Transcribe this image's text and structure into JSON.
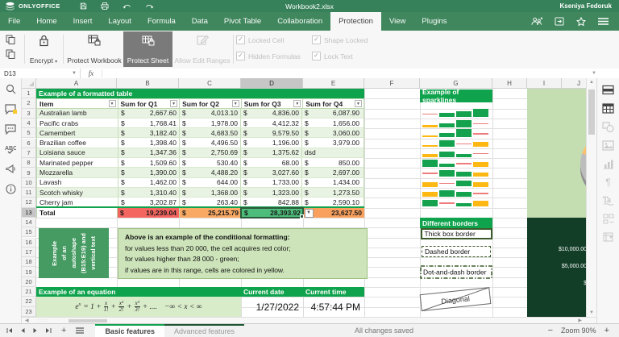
{
  "titlebar": {
    "logo_text": "ONLYOFFICE",
    "doc_title": "Workbook2.xlsx",
    "user_name": "Kseniya Fedoruk"
  },
  "menubar": {
    "tabs": [
      "File",
      "Home",
      "Insert",
      "Layout",
      "Formula",
      "Data",
      "Pivot Table",
      "Collaboration",
      "Protection",
      "View",
      "Plugins"
    ],
    "active_tab": "Protection"
  },
  "ribbon": {
    "encrypt_label": "Encrypt",
    "protect_workbook_label": "Protect Workbook",
    "protect_sheet_label": "Protect Sheet",
    "allow_edit_ranges_label": "Allow Edit Ranges",
    "checkboxes": [
      {
        "label": "Locked Cell",
        "checked": true
      },
      {
        "label": "Shape Locked",
        "checked": true
      },
      {
        "label": "Hidden Formulas",
        "checked": true
      },
      {
        "label": "Lock Text",
        "checked": true
      }
    ]
  },
  "formula_bar": {
    "name_box": "D13",
    "fx_label": "fx",
    "value": ""
  },
  "grid": {
    "column_letters": [
      "A",
      "B",
      "C",
      "D",
      "E",
      "F",
      "G",
      "H",
      "I",
      "J"
    ],
    "active_column": "D",
    "row_count": 23,
    "active_row": 13
  },
  "table": {
    "title": "Example of a formatted table",
    "currency": "$",
    "headers": [
      "Item",
      "Sum for Q1",
      "Sum for Q2",
      "Sum for Q3",
      "Sum for Q4"
    ],
    "rows": [
      {
        "item": "Australian lamb",
        "q1": "2,667.60",
        "q2": "4,013.10",
        "q3": "4,836.00",
        "q4": "6,087.90"
      },
      {
        "item": "Pacific crabs",
        "q1": "1,768.41",
        "q2": "1,978.00",
        "q3": "4,412.32",
        "q4": "1,656.00"
      },
      {
        "item": "Camembert",
        "q1": "3,182.40",
        "q2": "4,683.50",
        "q3": "9,579.50",
        "q4": "3,060.00"
      },
      {
        "item": "Brazilian coffee",
        "q1": "1,398.40",
        "q2": "4,496.50",
        "q3": "1,196.00",
        "q4": "3,979.00"
      },
      {
        "item": "Loisiana sauce",
        "q1": "1,347.36",
        "q2": "2,750.69",
        "q3": "1,375.62",
        "q4": "dsd",
        "q4_is_text": true
      },
      {
        "item": "Marinated pepper",
        "q1": "1,509.60",
        "q2": "530.40",
        "q3": "68.00",
        "q4": "850.00"
      },
      {
        "item": "Mozzarella",
        "q1": "1,390.00",
        "q2": "4,488.20",
        "q3": "3,027.60",
        "q4": "2,697.00"
      },
      {
        "item": "Lavash",
        "q1": "1,462.00",
        "q2": "644.00",
        "q3": "1,733.00",
        "q4": "1,434.00"
      },
      {
        "item": "Scotch whisky",
        "q1": "1,310.40",
        "q2": "1,368.00",
        "q3": "1,323.00",
        "q4": "1,273.50"
      },
      {
        "item": "Cherry jam",
        "q1": "3,202.87",
        "q2": "263.40",
        "q3": "842.88",
        "q4": "2,590.10"
      }
    ],
    "total": {
      "label": "Total",
      "q1": "19,239.04",
      "q2": "25,215.79",
      "q3": "28,393.92",
      "q4": "23,627.50"
    },
    "total_colors": {
      "q1": "#f4655f",
      "q2": "#f9a963",
      "q3": "#4ebd7b",
      "q4": "#f9a05e"
    }
  },
  "sparklines": {
    "title": "Example of sparklines",
    "colors": {
      "g": "#15a24e",
      "y": "#fdb813",
      "r": "#ef7c7c"
    },
    "rows": [
      [
        {
          "c": "r",
          "h": 0
        },
        {
          "c": "g",
          "h": 0.5
        },
        {
          "c": "g",
          "h": 0.72
        },
        {
          "c": "g",
          "h": 0.95
        }
      ],
      [
        {
          "c": "y",
          "h": 0.18
        },
        {
          "c": "g",
          "h": 0.34
        },
        {
          "c": "g",
          "h": 0.85
        },
        {
          "c": "r",
          "h": 0
        }
      ],
      [
        {
          "c": "y",
          "h": 0.15
        },
        {
          "c": "g",
          "h": 0.42
        },
        {
          "c": "g",
          "h": 0.9
        },
        {
          "c": "r",
          "h": 0
        }
      ],
      [
        {
          "c": "y",
          "h": 0.15
        },
        {
          "c": "g",
          "h": 0.8
        },
        {
          "c": "r",
          "h": 0
        },
        {
          "c": "y",
          "h": 0.6
        }
      ],
      [
        {
          "c": "y",
          "h": 0.3
        },
        {
          "c": "g",
          "h": 0.62
        },
        {
          "c": "g",
          "h": 0.32
        },
        {
          "c": "r",
          "h": 0
        }
      ],
      [
        {
          "c": "g",
          "h": 0.85
        },
        {
          "c": "g",
          "h": 0.3
        },
        {
          "c": "r",
          "h": 0
        },
        {
          "c": "y",
          "h": 0.48
        }
      ],
      [
        {
          "c": "r",
          "h": 0
        },
        {
          "c": "g",
          "h": 0.8
        },
        {
          "c": "g",
          "h": 0.55
        },
        {
          "c": "y",
          "h": 0.48
        }
      ],
      [
        {
          "c": "y",
          "h": 0.5
        },
        {
          "c": "r",
          "h": 0
        },
        {
          "c": "g",
          "h": 0.65
        },
        {
          "c": "y",
          "h": 0.5
        }
      ],
      [
        {
          "c": "y",
          "h": 0.52
        },
        {
          "c": "g",
          "h": 0.72
        },
        {
          "c": "g",
          "h": 0.5
        },
        {
          "c": "r",
          "h": 0
        }
      ],
      [
        {
          "c": "g",
          "h": 0.78
        },
        {
          "c": "r",
          "h": 0
        },
        {
          "c": "g",
          "h": 0.28
        },
        {
          "c": "y",
          "h": 0.62
        }
      ]
    ]
  },
  "borders_demo": {
    "title": "Different borders",
    "thick": "Thick box border",
    "dashed": "Dashed border",
    "dotdash": "Dot-and-dash border",
    "diagonal": "Diagonal"
  },
  "autoshape": {
    "lines": [
      "Example",
      "of an",
      "autoshape",
      "(B15:E19) and",
      "vertical text"
    ]
  },
  "conditional_note": {
    "title": "Above is an example of the conditional formatting:",
    "lines": [
      "for values less than 20 000, the cell acquires red color;",
      "for values higher than 28 000 - green;",
      "if values are in this range, cells are colored in yellow."
    ]
  },
  "equation": {
    "header": "Example of an equation",
    "base": "e",
    "exponent": "x",
    "lead": "= 1 +",
    "plus": "+",
    "fracs": [
      {
        "n": "x",
        "d": "1!"
      },
      {
        "n": "x²",
        "d": "2!"
      },
      {
        "n": "x³",
        "d": "3!"
      }
    ],
    "tail": "+ ....",
    "range": "−∞ < x < ∞",
    "date_header": "Current date",
    "time_header": "Current time",
    "date_value": "1/27/2022",
    "time_value": "4:57:44 PM"
  },
  "side_chart": {
    "axis_labels": [
      "$10,000.00",
      "$5,000.00",
      "$"
    ]
  },
  "statusbar": {
    "sheet_tabs": [
      {
        "label": "Basic features",
        "active": true
      },
      {
        "label": "Advanced features",
        "active": false
      }
    ],
    "saved_text": "All changes saved",
    "zoom_label": "Zoom 90%"
  },
  "colors": {
    "accent_green": "#10a34d",
    "titlebar_green": "#37815a",
    "menubar_green": "#40875d",
    "total_red": "#f4655f",
    "total_orange": "#f9a963",
    "total_green": "#4ebd7b",
    "total_orange2": "#f9a05e"
  }
}
